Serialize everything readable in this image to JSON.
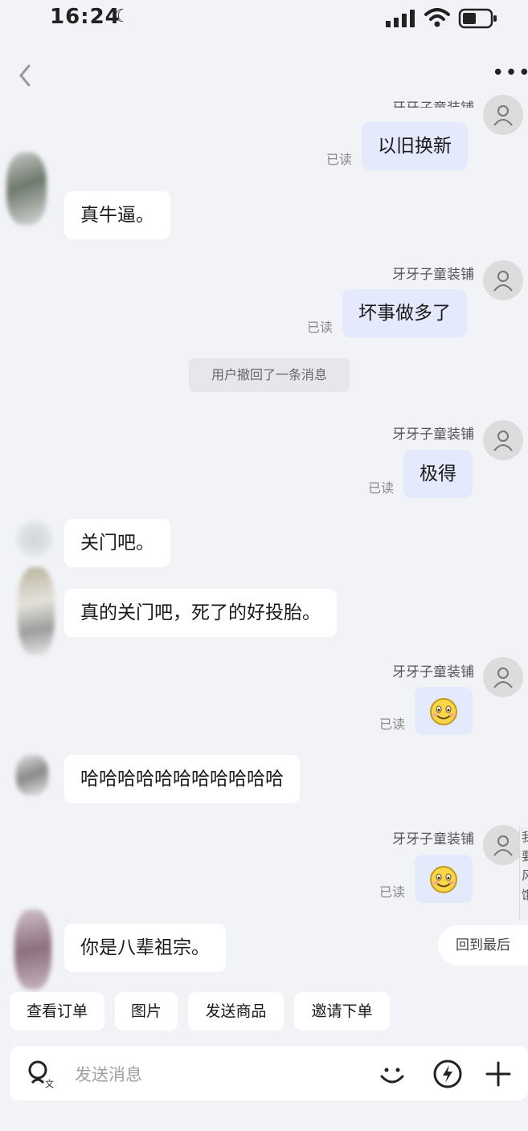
{
  "status_bar": {
    "time": "16:24"
  },
  "nav": {
    "back_icon": "chevron-left-icon",
    "more_icon": "more-dots-icon"
  },
  "messages": {
    "m1": {
      "sender": "牙牙子童装铺",
      "text": "以旧换新",
      "read": "已读"
    },
    "m2": {
      "text": "真牛逼。"
    },
    "m3": {
      "sender": "牙牙子童装铺",
      "text": "坏事做多了",
      "read": "已读"
    },
    "recall": "用户撤回了一条消息",
    "m4": {
      "sender": "牙牙子童装铺",
      "text": "极得",
      "read": "已读"
    },
    "m5": {
      "text": "关门吧。"
    },
    "m6": {
      "text": "真的关门吧，死了的好投胎。"
    },
    "m7": {
      "sender": "牙牙子童装铺",
      "read": "已读",
      "emoji": "smile-emoji-icon"
    },
    "m8": {
      "text": "哈哈哈哈哈哈哈哈哈哈哈"
    },
    "m9": {
      "sender": "牙牙子童装铺",
      "read": "已读",
      "emoji": "smile-emoji-icon"
    },
    "m10": {
      "text": "你是八辈祖宗。"
    }
  },
  "back_to_latest": "回到最后",
  "edge_chars": [
    "我",
    "要",
    "风",
    "饿"
  ],
  "quick_actions": [
    "查看订单",
    "图片",
    "发送商品",
    "邀请下单"
  ],
  "input": {
    "placeholder": "发送消息"
  },
  "colors": {
    "page_bg": "#f2f3f6",
    "my_bubble": "#e4e9fb",
    "other_bubble": "#ffffff"
  }
}
